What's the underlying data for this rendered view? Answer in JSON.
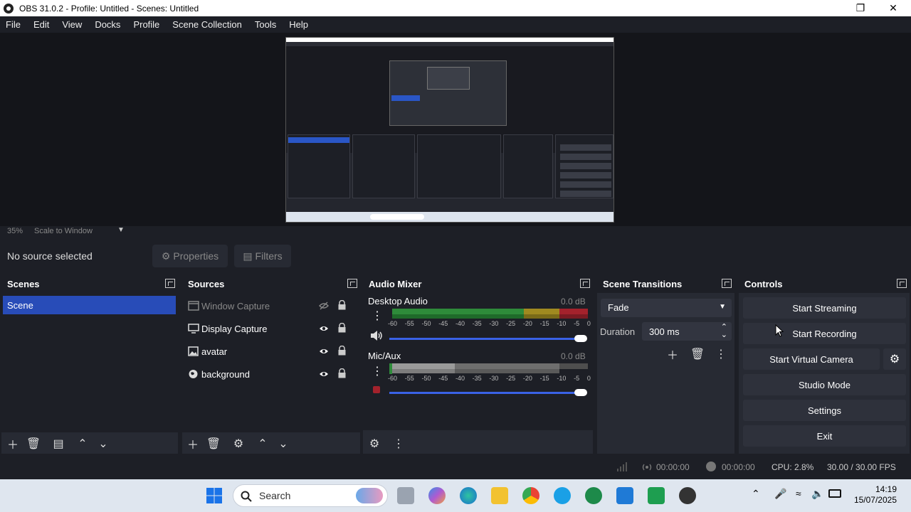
{
  "window": {
    "title": "OBS 31.0.2 - Profile: Untitled - Scenes: Untitled"
  },
  "menu": [
    "File",
    "Edit",
    "View",
    "Docks",
    "Profile",
    "Scene Collection",
    "Tools",
    "Help"
  ],
  "zoom": {
    "percent": "35%",
    "mode": "Scale to Window"
  },
  "context": {
    "no_source": "No source selected",
    "properties": "Properties",
    "filters": "Filters"
  },
  "scenes": {
    "title": "Scenes",
    "items": [
      "Scene"
    ]
  },
  "sources": {
    "title": "Sources",
    "items": [
      {
        "label": "Window Capture",
        "hidden": true
      },
      {
        "label": "Display Capture",
        "hidden": false
      },
      {
        "label": "avatar",
        "hidden": false
      },
      {
        "label": "background",
        "hidden": false
      }
    ]
  },
  "mixer": {
    "title": "Audio Mixer",
    "channels": [
      {
        "name": "Desktop Audio",
        "db": "0.0 dB",
        "muted": false
      },
      {
        "name": "Mic/Aux",
        "db": "0.0 dB",
        "muted": true
      }
    ],
    "ticks": [
      "-60",
      "-55",
      "-50",
      "-45",
      "-40",
      "-35",
      "-30",
      "-25",
      "-20",
      "-15",
      "-10",
      "-5",
      "0"
    ]
  },
  "transitions": {
    "title": "Scene Transitions",
    "type": "Fade",
    "duration_label": "Duration",
    "duration": "300 ms"
  },
  "controls": {
    "title": "Controls",
    "start_streaming": "Start Streaming",
    "start_recording": "Start Recording",
    "start_virtual_camera": "Start Virtual Camera",
    "studio_mode": "Studio Mode",
    "settings": "Settings",
    "exit": "Exit"
  },
  "status": {
    "stream_time": "00:00:00",
    "rec_time": "00:00:00",
    "cpu": "CPU: 2.8%",
    "fps": "30.00 / 30.00 FPS"
  },
  "taskbar": {
    "search": "Search",
    "time": "14:19",
    "date": "15/07/2025"
  },
  "colors": {
    "accent": "#284cb8",
    "meter_green": "#2e8b3a",
    "meter_yellow": "#a08a20",
    "meter_red": "#a3222c",
    "slider": "#3a62e6"
  }
}
